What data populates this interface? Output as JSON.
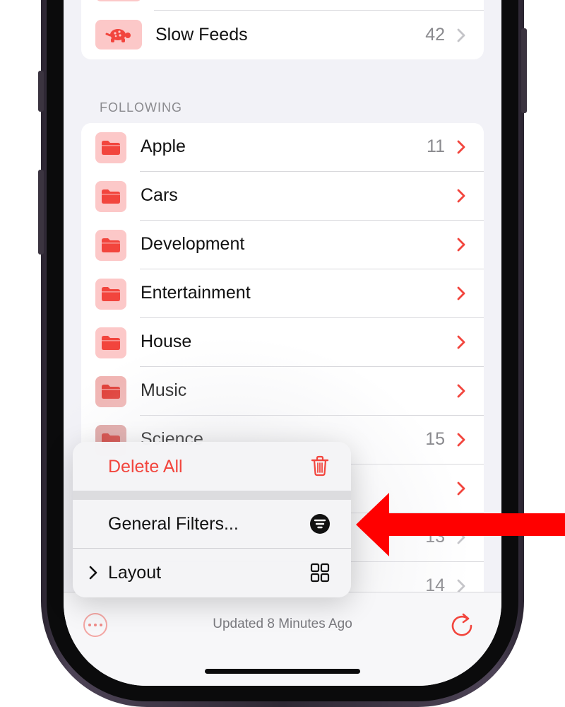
{
  "colors": {
    "accent": "#F2453D",
    "folder_bg": "#FCC8C8",
    "arrow": "#FF0000",
    "secondary_text": "#8A8A8E"
  },
  "top_group": {
    "slow_feeds": {
      "label": "Slow Feeds",
      "count": "42",
      "icon": "turtle-icon"
    }
  },
  "following": {
    "header": "FOLLOWING",
    "items": [
      {
        "label": "Apple",
        "count": "11"
      },
      {
        "label": "Cars",
        "count": ""
      },
      {
        "label": "Development",
        "count": ""
      },
      {
        "label": "Entertainment",
        "count": ""
      },
      {
        "label": "House",
        "count": ""
      },
      {
        "label": "Music",
        "count": ""
      },
      {
        "label": "Science",
        "count": "15"
      },
      {
        "label": "",
        "count": ""
      },
      {
        "label": "",
        "count": "13"
      },
      {
        "label": "",
        "count": "14"
      }
    ]
  },
  "context_menu": {
    "delete_all": {
      "label": "Delete All",
      "icon": "trash-icon"
    },
    "general_filters": {
      "label": "General Filters...",
      "icon": "filter-icon"
    },
    "layout": {
      "label": "Layout",
      "icon": "grid-icon"
    }
  },
  "toolbar": {
    "status": "Updated 8 Minutes Ago",
    "more_icon": "ellipsis-circle-icon",
    "refresh_icon": "refresh-icon"
  }
}
